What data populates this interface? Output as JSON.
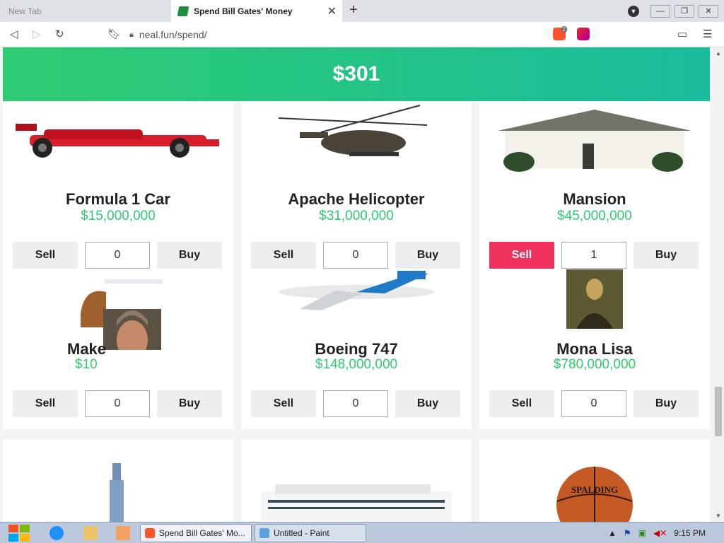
{
  "browser": {
    "tabs": [
      {
        "title": "New Tab",
        "active": false
      },
      {
        "title": "Spend Bill Gates' Money",
        "active": true
      }
    ],
    "url": "neal.fun/spend/",
    "extension_badge": "2"
  },
  "page": {
    "money": "$301",
    "items": [
      {
        "name": "Formula 1 Car",
        "price": "$15,000,000",
        "qty": "0",
        "sell": "Sell",
        "buy": "Buy"
      },
      {
        "name": "Apache Helicopter",
        "price": "$31,000,000",
        "qty": "0",
        "sell": "Sell",
        "buy": "Buy"
      },
      {
        "name": "Mansion",
        "price": "$45,000,000",
        "qty": "1",
        "sell": "Sell",
        "buy": "Buy"
      },
      {
        "name": "Make",
        "price": "$10",
        "qty": "0",
        "sell": "Sell",
        "buy": "Buy"
      },
      {
        "name": "Boeing 747",
        "price": "$148,000,000",
        "qty": "0",
        "sell": "Sell",
        "buy": "Buy"
      },
      {
        "name": "Mona Lisa",
        "price": "$780,000,000",
        "qty": "0",
        "sell": "Sell",
        "buy": "Buy"
      }
    ],
    "sell_active_color": "#f0325e",
    "price_color": "#2ecc71",
    "basketball_text": "SPALDING"
  },
  "taskbar": {
    "tasks": [
      {
        "label": "Spend Bill Gates' Mo...",
        "active": true
      },
      {
        "label": "Untitled - Paint",
        "active": false
      }
    ],
    "time": "9:15 PM"
  }
}
